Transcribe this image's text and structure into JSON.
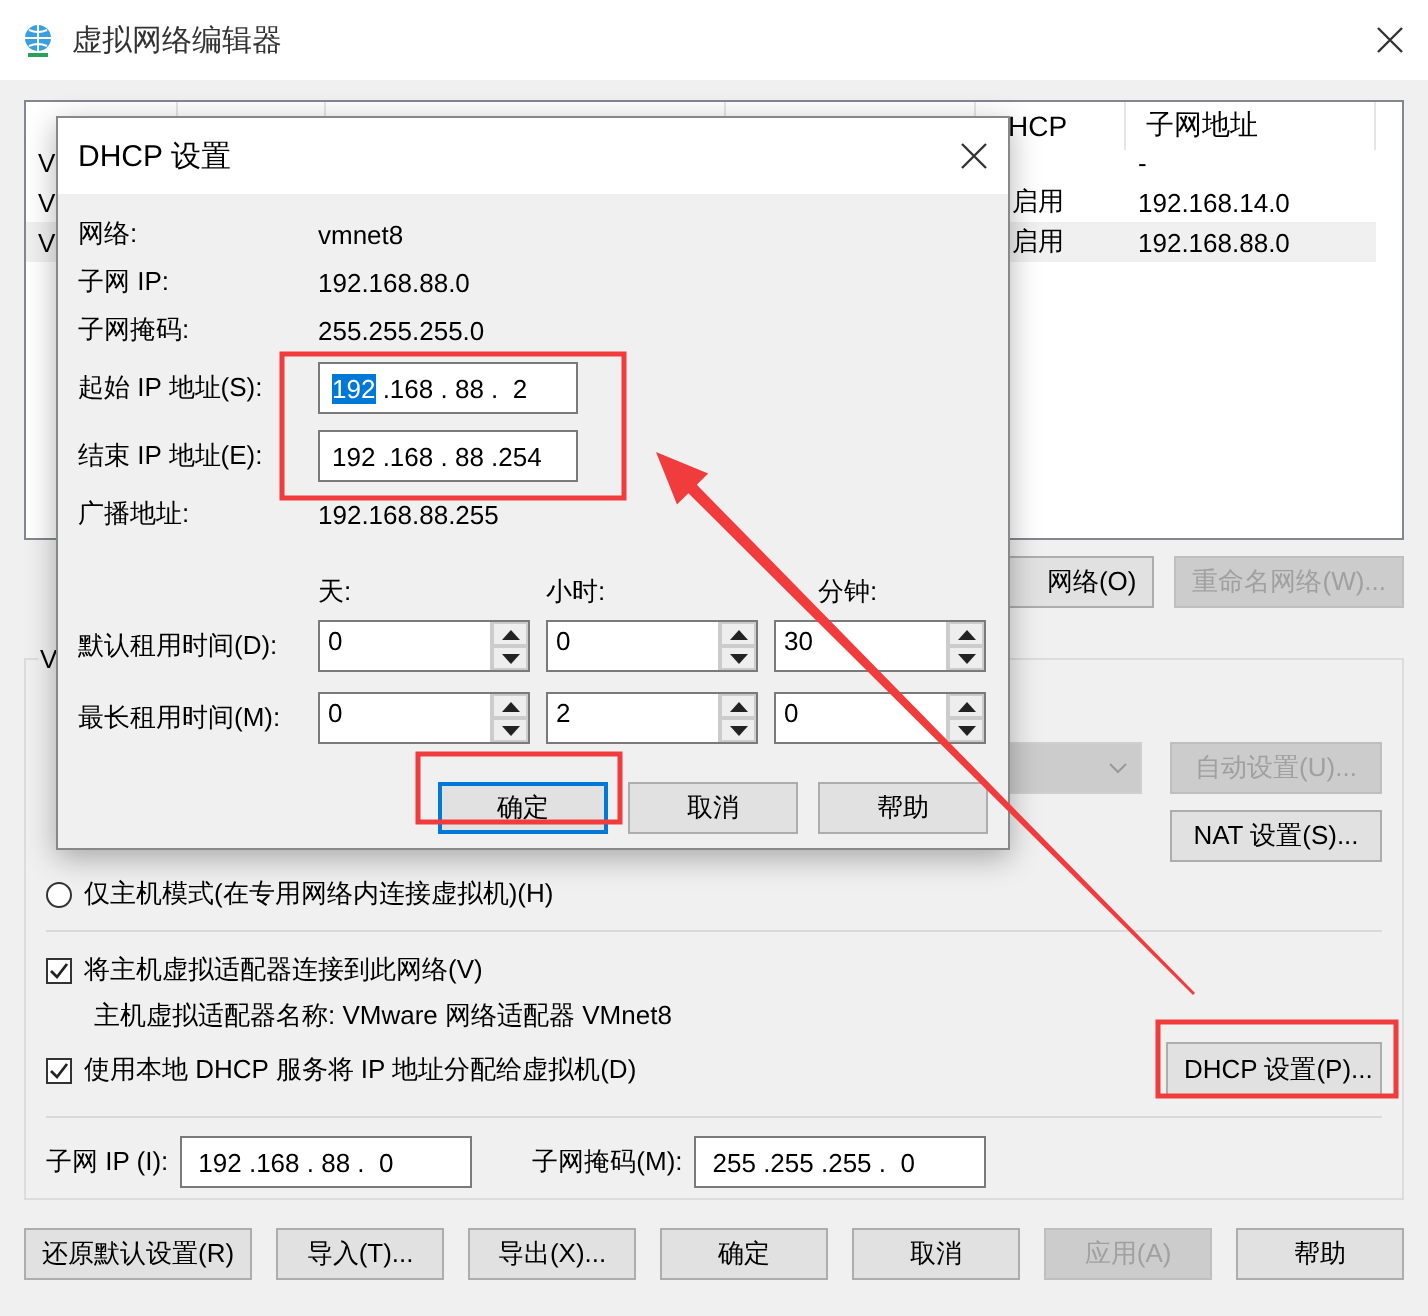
{
  "window": {
    "title": "虚拟网络编辑器"
  },
  "table": {
    "columns": [
      "HCP",
      "子网地址"
    ],
    "rows": [
      {
        "name": "V",
        "subnet": "-",
        "selected": false
      },
      {
        "name": "V",
        "dhcp": "启用",
        "subnet": "192.168.14.0",
        "selected": false
      },
      {
        "name": "V",
        "dhcp": "启用",
        "subnet": "192.168.88.0",
        "selected": true
      }
    ]
  },
  "network_buttons": [
    {
      "label": "网络(O)",
      "disabled": false
    },
    {
      "label": "重命名网络(W)...",
      "disabled": true
    }
  ],
  "group": {
    "legend": "V",
    "modes": [
      {
        "kind": "hidden"
      },
      {
        "kind": "hidden"
      },
      {
        "kind": "radio",
        "label": "仅主机模式(在专用网络内连接虚拟机)(H)",
        "selected": false
      }
    ],
    "nat_dropdown": {
      "disabled": true
    },
    "auto_button": {
      "label": "自动设置(U)...",
      "disabled": true
    },
    "nat_button": {
      "label": "NAT 设置(S)...",
      "disabled": false
    },
    "connect_adapter": {
      "label": "将主机虚拟适配器连接到此网络(V)",
      "checked": true
    },
    "adapter_name": "主机虚拟适配器名称: VMware 网络适配器 VMnet8",
    "use_dhcp": {
      "label": "使用本地 DHCP 服务将 IP 地址分配给虚拟机(D)",
      "checked": true
    },
    "dhcp_button": {
      "label": "DHCP 设置(P)..."
    },
    "subnet_ip": {
      "label": "子网 IP (I):",
      "value": "192 .168 . 88 .  0"
    },
    "subnet_mask": {
      "label": "子网掩码(M):",
      "value": "255 .255 .255 .  0"
    }
  },
  "buttons": [
    {
      "label": "还原默认设置(R)",
      "disabled": false
    },
    {
      "label": "导入(T)...",
      "disabled": false
    },
    {
      "label": "导出(X)...",
      "disabled": false
    },
    {
      "label": "确定",
      "disabled": false
    },
    {
      "label": "取消",
      "disabled": false
    },
    {
      "label": "应用(A)",
      "disabled": true
    },
    {
      "label": "帮助",
      "disabled": false
    }
  ],
  "dialog": {
    "title": "DHCP 设置",
    "info": [
      {
        "label": "网络:",
        "value": "vmnet8"
      },
      {
        "label": "子网 IP:",
        "value": "192.168.88.0"
      },
      {
        "label": "子网掩码:",
        "value": "255.255.255.0"
      }
    ],
    "ranges": [
      {
        "label": "起始 IP 地址(S):",
        "segments": [
          {
            "text": "192",
            "selected": true
          },
          {
            "text": " .168",
            "selected": false
          },
          {
            "text": " . 88",
            "selected": false
          },
          {
            "text": " .  2",
            "selected": false
          }
        ]
      },
      {
        "label": "结束 IP 地址(E):",
        "segments": [
          {
            "text": "192",
            "selected": false
          },
          {
            "text": " .168",
            "selected": false
          },
          {
            "text": " . 88",
            "selected": false
          },
          {
            "text": " .254",
            "selected": false
          }
        ]
      }
    ],
    "broadcast": {
      "label": "广播地址:",
      "value": "192.168.88.255"
    },
    "lease": {
      "headers": [
        "天:",
        "小时:",
        "分钟:"
      ],
      "rows": [
        {
          "label": "默认租用时间(D):",
          "values": [
            "0",
            "0",
            "30"
          ]
        },
        {
          "label": "最长租用时间(M):",
          "values": [
            "0",
            "2",
            "0"
          ]
        }
      ]
    },
    "buttons": [
      {
        "label": "确定",
        "default": true
      },
      {
        "label": "取消",
        "default": false
      },
      {
        "label": "帮助",
        "default": false
      }
    ]
  }
}
